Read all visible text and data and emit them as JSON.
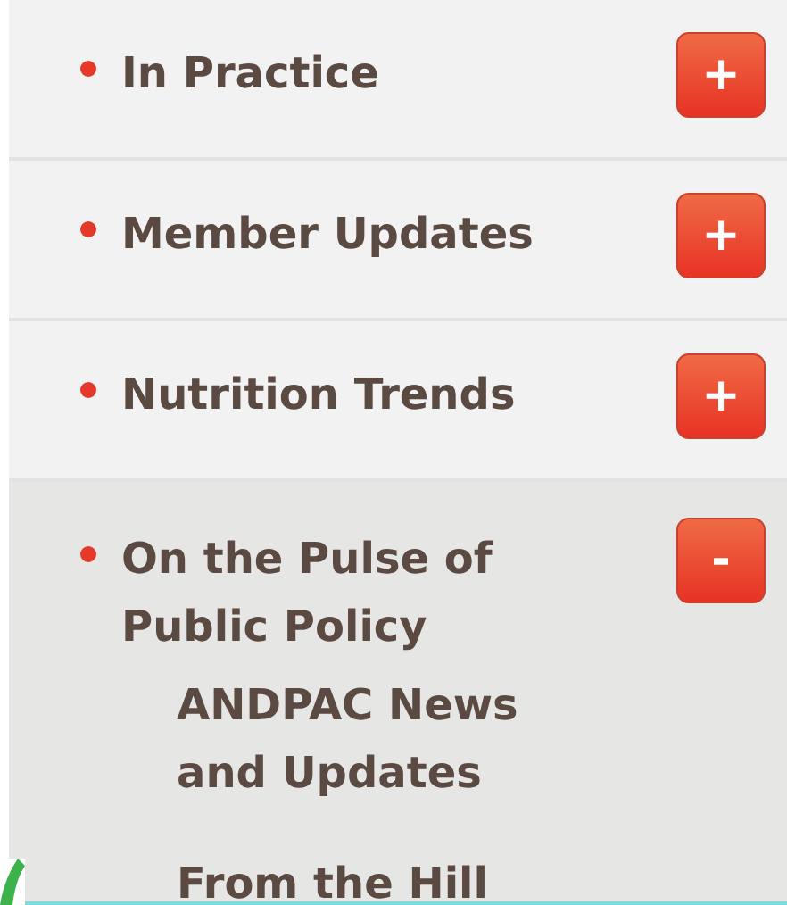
{
  "sections": [
    {
      "title": "In Practice",
      "toggle": "+",
      "expanded": false
    },
    {
      "title": "Member Updates",
      "toggle": "+",
      "expanded": false
    },
    {
      "title": "Nutrition Trends",
      "toggle": "+",
      "expanded": false
    },
    {
      "title": "On the Pulse of Public Policy",
      "toggle": "-",
      "expanded": true,
      "children": [
        "ANDPAC News and Updates",
        "From the Hill"
      ]
    }
  ]
}
